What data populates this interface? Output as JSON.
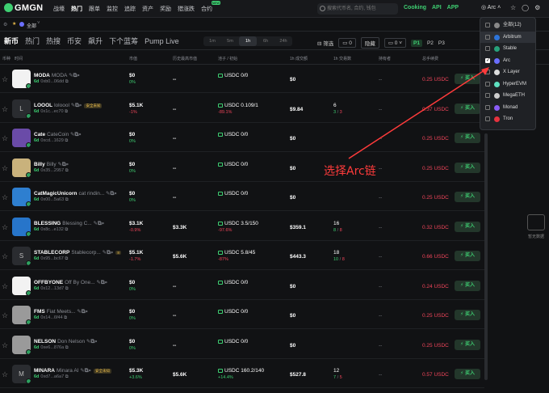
{
  "top": {
    "logo": "GMGN",
    "nav": [
      "战壕",
      "热门",
      "跟单",
      "监控",
      "追踪",
      "资产",
      "奖励",
      "猎涨跌",
      "合约"
    ],
    "search_placeholder": "搜索代币名, 合约, 钱包",
    "cooking": "Cooking",
    "api": "API",
    "app": "APP",
    "chain": "Arc"
  },
  "subbar": {
    "label": "全部"
  },
  "filter": {
    "tabs": [
      "新币",
      "热门",
      "热搜",
      "币安",
      "飙升",
      "下个蓝筹",
      "Pump Live"
    ],
    "timeframes": [
      "1m",
      "5m",
      "1h",
      "6h",
      "24h"
    ],
    "screen": "筛选",
    "count": "0",
    "toggle": "隐藏",
    "p_buttons": [
      "P1",
      "P2",
      "P3"
    ]
  },
  "headers": [
    "币种",
    "时间",
    "市值",
    "历史最高市值",
    "池子 / 初始",
    "1h 成交额",
    "1h 交易数",
    "持有者",
    "总手续费",
    "买入"
  ],
  "rows": [
    {
      "name": "MODA",
      "sym": "MODA",
      "age": "6d",
      "addr": "0xb0...06dd",
      "mcap": "$0",
      "mchg": "0%",
      "mchg_color": "green",
      "ath": "--",
      "liq": "USDC 0/0",
      "liq_sub": "",
      "vol": "$0",
      "tx": "",
      "tx_sub": "",
      "holders": "--",
      "fee": "0.25 USDC",
      "buy": "买入",
      "avatar": "white",
      "tag": ""
    },
    {
      "name": "LOOOL",
      "sym": "loloool",
      "age": "6d",
      "addr": "0x1c...ec70",
      "mcap": "$5.1K",
      "mchg": "-1%",
      "mchg_color": "red",
      "ath": "--",
      "liq": "USDC 0.109/1",
      "liq_sub": "-89.1%",
      "vol": "$9.84",
      "tx": "6",
      "tx_sub": "3 / 3",
      "holders": "--",
      "fee": "0.37 USDC",
      "buy": "买入",
      "avatar": "L",
      "tag": "安全未知"
    },
    {
      "name": "Cate",
      "sym": "CateCoin",
      "age": "6d",
      "addr": "0xcd...1629",
      "mcap": "$0",
      "mchg": "0%",
      "mchg_color": "green",
      "ath": "--",
      "liq": "USDC 0/0",
      "liq_sub": "",
      "vol": "$0",
      "tx": "",
      "tx_sub": "",
      "holders": "--",
      "fee": "0.25 USDC",
      "buy": "买入",
      "avatar": "purple",
      "tag": ""
    },
    {
      "name": "Billy",
      "sym": "Billy",
      "age": "6d",
      "addr": "0x35...2957",
      "mcap": "$0",
      "mchg": "0%",
      "mchg_color": "green",
      "ath": "--",
      "liq": "USDC 0/0",
      "liq_sub": "",
      "vol": "$0",
      "tx": "",
      "tx_sub": "",
      "holders": "--",
      "fee": "0.25 USDC",
      "buy": "买入",
      "avatar": "tan",
      "tag": ""
    },
    {
      "name": "CatMagicUnicorn",
      "sym": "cat rindin...",
      "age": "6d",
      "addr": "0x00...5a63",
      "mcap": "$0",
      "mchg": "0%",
      "mchg_color": "green",
      "ath": "--",
      "liq": "USDC 0/0",
      "liq_sub": "",
      "vol": "$0",
      "tx": "",
      "tx_sub": "",
      "holders": "--",
      "fee": "0.25 USDC",
      "buy": "买入",
      "avatar": "blue",
      "tag": ""
    },
    {
      "name": "BLESSING",
      "sym": "Blessing C...",
      "age": "6d",
      "addr": "0x8c...e132",
      "mcap": "$3.1K",
      "mchg": "-0.9%",
      "mchg_color": "red",
      "ath": "$3.3K",
      "liq": "USDC 3.5/150",
      "liq_sub": "-97.6%",
      "vol": "$359.1",
      "tx": "16",
      "tx_sub": "8 / 8",
      "holders": "--",
      "fee": "0.32 USDC",
      "buy": "买入",
      "avatar": "usdc",
      "tag": ""
    },
    {
      "name": "STABLECORP",
      "sym": "Stablecorp...",
      "age": "6d",
      "addr": "0x95...bc67",
      "mcap": "$5.1K",
      "mchg": "-1.7%",
      "mchg_color": "red",
      "ath": "$5.6K",
      "liq": "USDC 5.8/45",
      "liq_sub": "-87%",
      "vol": "$443.3",
      "tx": "18",
      "tx_sub": "10 / 8",
      "holders": "--",
      "fee": "0.66 USDC",
      "buy": "买入",
      "avatar": "S",
      "tag": "8"
    },
    {
      "name": "OFFBYONE",
      "sym": "Off By One...",
      "age": "6d",
      "addr": "0x12...13d7",
      "mcap": "$0",
      "mchg": "0%",
      "mchg_color": "green",
      "ath": "--",
      "liq": "USDC 0/0",
      "liq_sub": "",
      "vol": "$0",
      "tx": "",
      "tx_sub": "",
      "holders": "--",
      "fee": "0.24 USDC",
      "buy": "买入",
      "avatar": "white",
      "tag": ""
    },
    {
      "name": "FMS",
      "sym": "Fiat Meets...",
      "age": "6d",
      "addr": "0x14...6f44",
      "mcap": "$0",
      "mchg": "0%",
      "mchg_color": "green",
      "ath": "--",
      "liq": "USDC 0/0",
      "liq_sub": "",
      "vol": "$0",
      "tx": "",
      "tx_sub": "",
      "holders": "--",
      "fee": "0.25 USDC",
      "buy": "买入",
      "avatar": "gray",
      "tag": ""
    },
    {
      "name": "NELSON",
      "sym": "Don Nelson",
      "age": "6d",
      "addr": "0xe6...876a",
      "mcap": "$0",
      "mchg": "0%",
      "mchg_color": "green",
      "ath": "--",
      "liq": "USDC 0/0",
      "liq_sub": "",
      "vol": "$0",
      "tx": "",
      "tx_sub": "",
      "holders": "--",
      "fee": "0.25 USDC",
      "buy": "买入",
      "avatar": "gray",
      "tag": ""
    },
    {
      "name": "MINARA",
      "sym": "Minara AI",
      "age": "6d",
      "addr": "0xd7...a6a7",
      "mcap": "$5.3K",
      "mchg": "+3.6%",
      "mchg_color": "green",
      "ath": "$5.6K",
      "liq": "USDC 160.2/140",
      "liq_sub": "+14.4%",
      "vol": "$527.8",
      "tx": "12",
      "tx_sub": "7 / 5",
      "holders": "--",
      "fee": "0.57 USDC",
      "buy": "买入",
      "avatar": "M",
      "tag": "安全未知"
    }
  ],
  "dropdown": [
    {
      "label": "全部(12)",
      "checked": false,
      "color": "#888888"
    },
    {
      "label": "Arbitrum",
      "checked": false,
      "color": "#2d74da"
    },
    {
      "label": "Stable",
      "checked": false,
      "color": "#27a17a"
    },
    {
      "label": "Arc",
      "checked": true,
      "color": "#6b6fff"
    },
    {
      "label": "X Layer",
      "checked": false,
      "color": "#dddddd"
    },
    {
      "label": "HyperEVM",
      "checked": false,
      "color": "#5ee0c0"
    },
    {
      "label": "MegaETH",
      "checked": false,
      "color": "#cccccc"
    },
    {
      "label": "Monad",
      "checked": false,
      "color": "#8a5cf6"
    },
    {
      "label": "Tron",
      "checked": false,
      "color": "#e6323e"
    }
  ],
  "empty_text": "暂无数据",
  "annotation": "选择Arc链"
}
